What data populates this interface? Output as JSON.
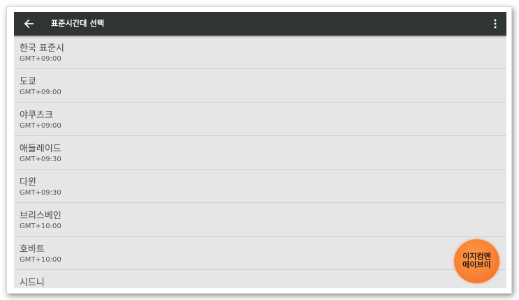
{
  "appbar": {
    "title": "표준시간대 선택",
    "back_icon": "arrow-left-icon",
    "overflow_icon": "more-vert-icon",
    "background": "#2f3435"
  },
  "timezones": [
    {
      "name": "한국 표준시",
      "offset": "GMT+09:00"
    },
    {
      "name": "도쿄",
      "offset": "GMT+09:00"
    },
    {
      "name": "야쿠츠크",
      "offset": "GMT+09:00"
    },
    {
      "name": "애들레이드",
      "offset": "GMT+09:30"
    },
    {
      "name": "다윈",
      "offset": "GMT+09:30"
    },
    {
      "name": "브리스베인",
      "offset": "GMT+10:00"
    },
    {
      "name": "호바트",
      "offset": "GMT+10:00"
    },
    {
      "name": "시드니",
      "offset": ""
    }
  ],
  "watermark": {
    "line1": "이지컴앤",
    "line2": "에이브이",
    "color": "#f57a2d"
  }
}
